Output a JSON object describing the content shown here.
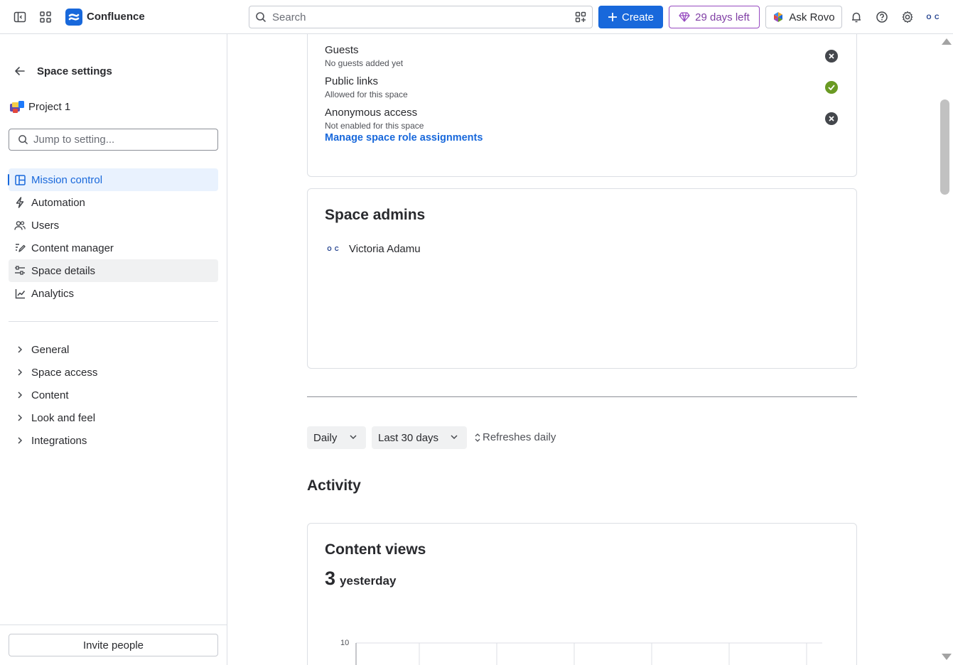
{
  "topbar": {
    "brand": "Confluence",
    "search_placeholder": "Search",
    "create_label": "Create",
    "trial_label": "29 days left",
    "rovo_label": "Ask Rovo",
    "avatar_initials": "O C"
  },
  "sidebar": {
    "title": "Space settings",
    "space_name": "Project 1",
    "jump_placeholder": "Jump to setting...",
    "nav": [
      {
        "label": "Mission control",
        "icon": "layout-icon",
        "state": "active"
      },
      {
        "label": "Automation",
        "icon": "lightning-icon"
      },
      {
        "label": "Users",
        "icon": "people-icon"
      },
      {
        "label": "Content manager",
        "icon": "pen-icon"
      },
      {
        "label": "Space details",
        "icon": "sliders-icon",
        "state": "hover"
      },
      {
        "label": "Analytics",
        "icon": "chart-line-icon"
      }
    ],
    "sections": [
      "General",
      "Space access",
      "Content",
      "Look and feel",
      "Integrations"
    ],
    "invite_label": "Invite people"
  },
  "permissions": {
    "rows": [
      {
        "title": "Guests",
        "subtitle": "No guests added yet",
        "status": "disabled"
      },
      {
        "title": "Public links",
        "subtitle": "Allowed for this space",
        "status": "enabled"
      },
      {
        "title": "Anonymous access",
        "subtitle": "Not enabled for this space",
        "status": "disabled"
      }
    ],
    "manage_link": "Manage space role assignments"
  },
  "admins": {
    "title": "Space admins",
    "people": [
      {
        "name": "Victoria Adamu",
        "initials": "O C"
      }
    ]
  },
  "filters": {
    "granularity": "Daily",
    "range": "Last 30 days",
    "refresh": "Refreshes daily"
  },
  "activity": {
    "heading": "Activity",
    "content_views": {
      "title": "Content views",
      "count": "3",
      "count_label": "yesterday",
      "y_tick_top": "10"
    }
  },
  "colors": {
    "accent": "#1868db",
    "enabled": "#6a9a23",
    "disabled": "#44474c",
    "trial": "#803fa5"
  }
}
